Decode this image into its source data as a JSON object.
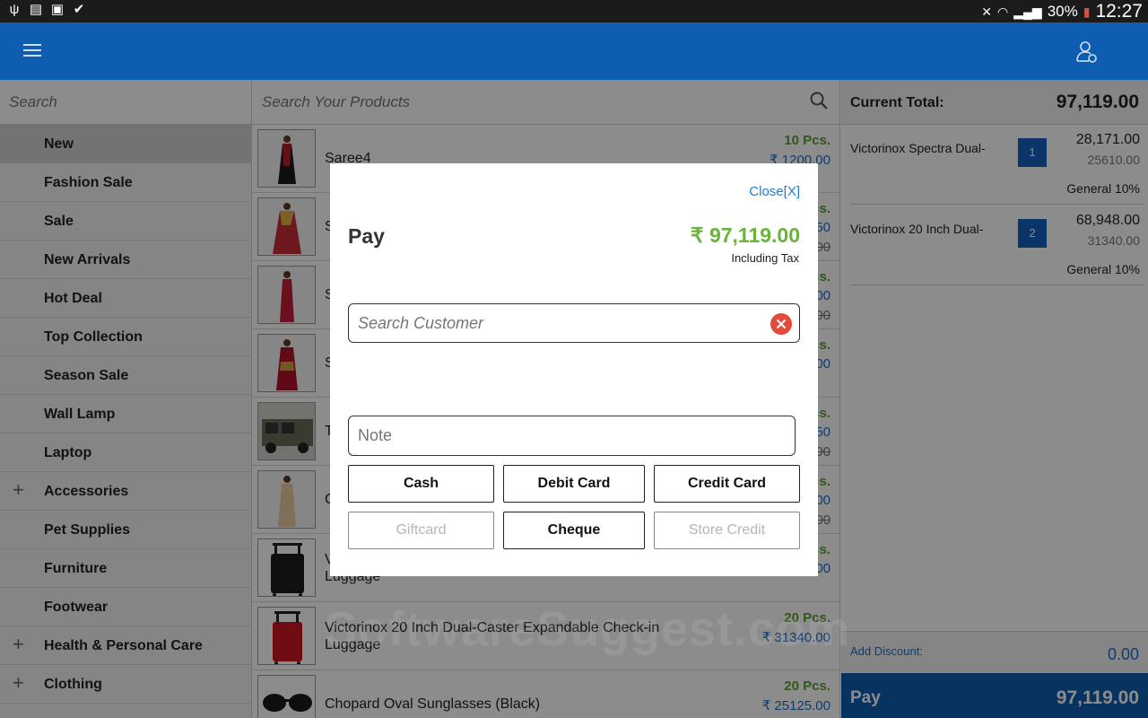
{
  "status_bar": {
    "battery": "30%",
    "time": "12:27"
  },
  "sidebar": {
    "search_placeholder": "Search",
    "categories": [
      {
        "label": "New",
        "active": true,
        "expandable": false
      },
      {
        "label": "Fashion Sale",
        "expandable": false
      },
      {
        "label": "Sale",
        "expandable": false
      },
      {
        "label": "New Arrivals",
        "expandable": false
      },
      {
        "label": "Hot Deal",
        "expandable": false
      },
      {
        "label": "Top Collection",
        "expandable": false
      },
      {
        "label": "Season Sale",
        "expandable": false
      },
      {
        "label": "Wall Lamp",
        "expandable": false
      },
      {
        "label": "Laptop",
        "expandable": false
      },
      {
        "label": "Accessories",
        "expandable": true
      },
      {
        "label": "Pet Supplies",
        "expandable": false
      },
      {
        "label": "Furniture",
        "expandable": false
      },
      {
        "label": "Footwear",
        "expandable": false
      },
      {
        "label": "Health & Personal Care",
        "expandable": true
      },
      {
        "label": "Clothing",
        "expandable": true
      }
    ],
    "plus_glyph": "+"
  },
  "products": {
    "search_placeholder": "Search Your Products",
    "items": [
      {
        "name": "Saree4",
        "qty": "10 Pcs.",
        "price": "₹ 1200.00",
        "old_price": ""
      },
      {
        "name": "S",
        "qty": "Pcs.",
        "price": "50",
        "old_price": "00"
      },
      {
        "name": "S",
        "qty": "Pcs.",
        "price": "00",
        "old_price": "00"
      },
      {
        "name": "S",
        "qty": "Pcs.",
        "price": "00",
        "old_price": ""
      },
      {
        "name": "T",
        "qty": "Pcs.",
        "price": "50",
        "old_price": "00"
      },
      {
        "name": "C",
        "qty": "Pcs.",
        "price": "00",
        "old_price": "00"
      },
      {
        "name": "V\nLuggage",
        "qty": "Pcs.",
        "price": "00",
        "old_price": ""
      },
      {
        "name": "Victorinox 20 Inch Dual-Caster Expandable Check-in Luggage",
        "qty": "20 Pcs.",
        "price": "₹ 31340.00",
        "old_price": ""
      },
      {
        "name": "Chopard Oval Sunglasses  (Black)",
        "qty": "20 Pcs.",
        "price": "₹ 25125.00",
        "old_price": ""
      }
    ]
  },
  "cart": {
    "total_label": "Current Total:",
    "total_value": "97,119.00",
    "items": [
      {
        "name": "Victorinox Spectra Dual-",
        "qty": "1",
        "total": "28,171.00",
        "base": "25610.00",
        "tax": "General  10%"
      },
      {
        "name": "Victorinox 20 Inch Dual-",
        "qty": "2",
        "total": "68,948.00",
        "base": "31340.00",
        "tax": "General  10%"
      }
    ],
    "discount_label": "Add Discount:",
    "discount_value": "0.00",
    "pay_label": "Pay",
    "pay_value": "97,119.00"
  },
  "watermark": "SoftwareSuggest.com",
  "modal": {
    "close_label": "Close[X]",
    "title": "Pay",
    "amount": "₹ 97,119.00",
    "tax_note": "Including Tax",
    "customer_placeholder": "Search Customer",
    "note_placeholder": "Note",
    "buttons": {
      "cash": "Cash",
      "debit_card": "Debit Card",
      "credit_card": "Credit Card",
      "giftcard": "Giftcard",
      "cheque": "Cheque",
      "store_credit": "Store Credit"
    }
  },
  "colors": {
    "app_bar": "#0e5db0",
    "accent_green": "#6ab33d",
    "link_blue": "#1a7fd6",
    "clear_red": "#e24a3b"
  }
}
